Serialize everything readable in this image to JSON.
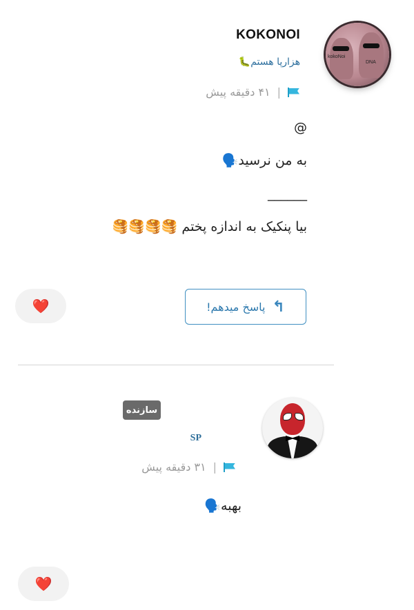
{
  "comments": [
    {
      "username": "KOKONOI",
      "bio": "هزارپا هستم🐛",
      "time": "۴۱ دقیقه پیش",
      "separator": "|",
      "avatar_tags": [
        "kokoNoi",
        "DNA"
      ],
      "body_lines": [
        "@",
        "به من نرسید🗣️",
        "______",
        "بیا پنکیک به اندازه پختم 🥞🥞🥞🥞"
      ],
      "reply_label": "پاسخ میدهم!",
      "like_icon": "❤️"
    },
    {
      "username": "SP",
      "badge": "سازنده",
      "time": "۳۱ دقیقه پیش",
      "separator": "|",
      "body": "بهبه🗣️",
      "like_icon": "❤️"
    }
  ],
  "colors": {
    "accent": "#2b78ad",
    "flag": "#35b6de",
    "like": "#e0243a",
    "badge_bg": "#6a6a6a"
  },
  "icons": {
    "reply": "reply-arrow-icon",
    "flag": "flag-icon",
    "like": "heart-icon"
  }
}
